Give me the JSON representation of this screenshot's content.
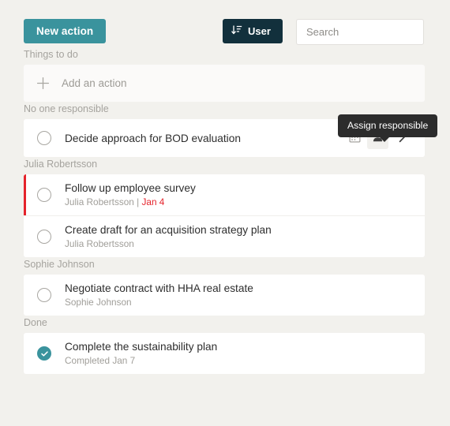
{
  "toolbar": {
    "new_action_label": "New action",
    "sort_button_label": "User",
    "sort_icon": "sort-descending-icon",
    "search_placeholder": "Search",
    "search_value": "",
    "search_icon": "search-icon"
  },
  "tooltip": {
    "text": "Assign responsible"
  },
  "colors": {
    "accent_teal": "#3a939d",
    "dark_navy": "#12303c",
    "overdue_red": "#e5232b",
    "background": "#f2f1ed",
    "card": "#ffffff",
    "tooltip_bg": "#2c2c2c"
  },
  "sections": [
    {
      "label": "Things to do",
      "type": "add",
      "add_label": "Add an action",
      "add_icon": "plus-icon"
    },
    {
      "label": "No one responsible",
      "type": "tasks",
      "items": [
        {
          "title": "Decide approach for BOD evaluation",
          "subtitle": "",
          "due": "",
          "overdue": false,
          "done": false,
          "actions": [
            "calendar-icon",
            "person-icon",
            "chevron-right-icon"
          ]
        }
      ]
    },
    {
      "label": "Julia Robertsson",
      "type": "tasks",
      "items": [
        {
          "title": "Follow up employee survey",
          "subtitle": "Julia Robertsson | ",
          "due": "Jan 4",
          "overdue": true,
          "done": false,
          "actions": []
        },
        {
          "title": "Create draft for an acquisition strategy plan",
          "subtitle": "Julia Robertsson",
          "due": "",
          "overdue": false,
          "done": false,
          "actions": []
        }
      ]
    },
    {
      "label": "Sophie Johnson",
      "type": "tasks",
      "items": [
        {
          "title": "Negotiate contract with HHA real estate",
          "subtitle": "Sophie Johnson",
          "due": "",
          "overdue": false,
          "done": false,
          "actions": []
        }
      ]
    },
    {
      "label": "Done",
      "type": "tasks",
      "items": [
        {
          "title": "Complete the sustainability plan",
          "subtitle": "Completed Jan 7",
          "due": "",
          "overdue": false,
          "done": true,
          "actions": []
        }
      ]
    }
  ]
}
